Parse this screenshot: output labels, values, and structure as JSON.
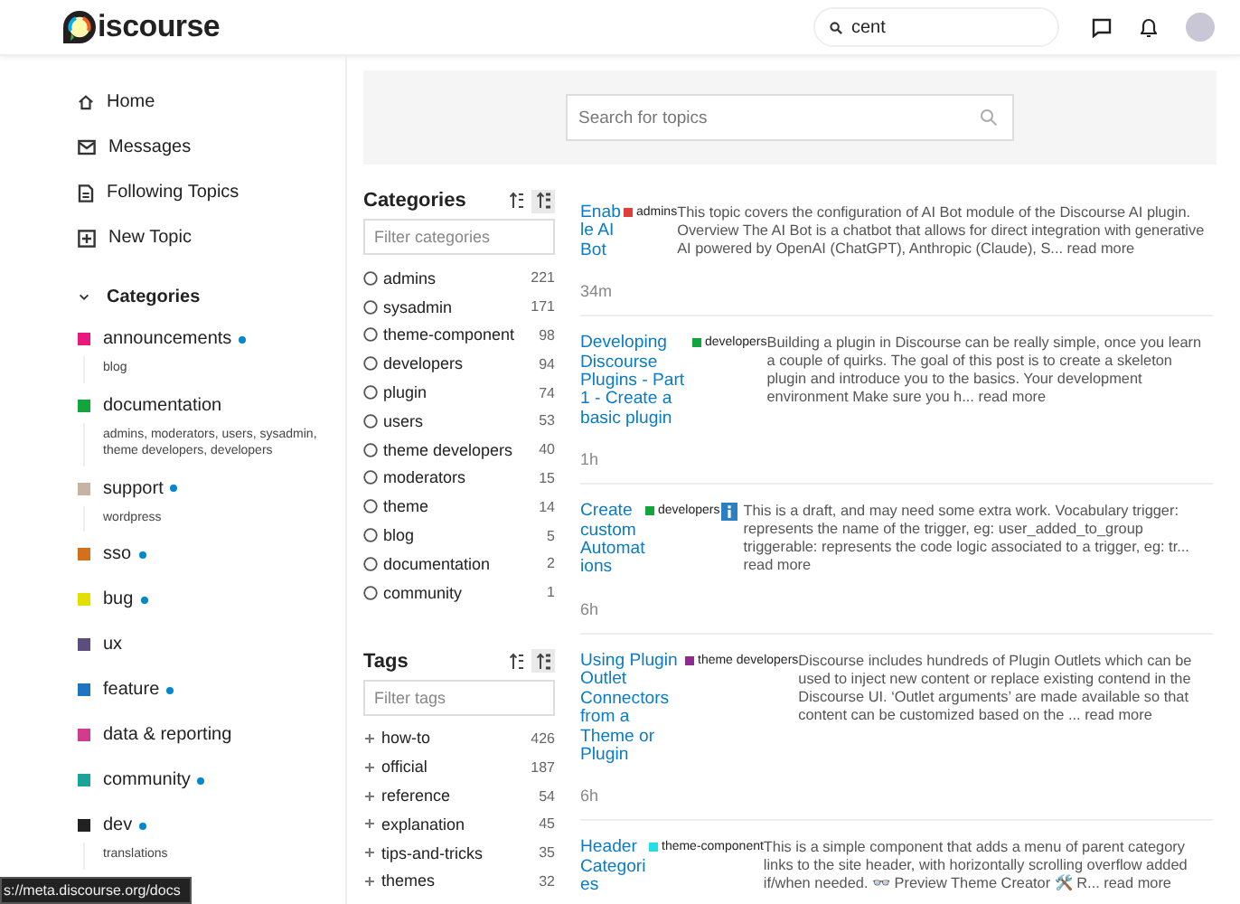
{
  "header": {
    "logo_text": "iscourse",
    "search": {
      "value": "cent"
    }
  },
  "sidebar": {
    "nav": [
      {
        "label": "Home"
      },
      {
        "label": "Messages"
      },
      {
        "label": "Following Topics"
      },
      {
        "label": "New Topic"
      }
    ],
    "categories_heading": "Categories",
    "categories": [
      {
        "name": "announcements",
        "color": "#e8197a",
        "unread": true,
        "subcategories": "blog"
      },
      {
        "name": "documentation",
        "color": "#12a53b",
        "unread": false,
        "subcategories": "admins, moderators, users, sysadmin, theme developers, developers"
      },
      {
        "name": "support",
        "color": "#c8b2a6",
        "unread": true,
        "subcategories": "wordpress"
      },
      {
        "name": "sso",
        "color": "#d4701c",
        "unread": true
      },
      {
        "name": "bug",
        "color": "#e3e000",
        "unread": true
      },
      {
        "name": "ux",
        "color": "#5b4e7e",
        "unread": false
      },
      {
        "name": "feature",
        "color": "#1f74c2",
        "unread": true
      },
      {
        "name": "data & reporting",
        "color": "#d13c8e",
        "unread": false
      },
      {
        "name": "community",
        "color": "#1ba397",
        "unread": true
      },
      {
        "name": "dev",
        "color": "#222222",
        "unread": true,
        "subcategories": "translations"
      }
    ]
  },
  "search_banner": {
    "placeholder": "Search for topics"
  },
  "filters": [
    {
      "kind": "radio",
      "heading": "Categories",
      "placeholder": "Filter categories",
      "sort": [
        {
          "selected": false
        },
        {
          "selected": true
        }
      ],
      "items": [
        {
          "name": "admins",
          "count": "221",
          "selected": false
        },
        {
          "name": "sysadmin",
          "count": "171",
          "selected": false
        },
        {
          "name": "theme-component",
          "count": "98",
          "selected": false
        },
        {
          "name": "developers",
          "count": "94",
          "selected": false
        },
        {
          "name": "plugin",
          "count": "74",
          "selected": false
        },
        {
          "name": "users",
          "count": "53",
          "selected": false
        },
        {
          "name": "theme developers",
          "count": "40",
          "selected": false
        },
        {
          "name": "moderators",
          "count": "15",
          "selected": false
        },
        {
          "name": "theme",
          "count": "14",
          "selected": false
        },
        {
          "name": "blog",
          "count": "5",
          "selected": false
        },
        {
          "name": "documentation",
          "count": "2",
          "selected": false
        },
        {
          "name": "community",
          "count": "1",
          "selected": false
        }
      ]
    },
    {
      "kind": "plus",
      "heading": "Tags",
      "placeholder": "Filter tags",
      "sort": [
        {
          "selected": false
        },
        {
          "selected": true
        }
      ],
      "items": [
        {
          "name": "how-to",
          "count": "426"
        },
        {
          "name": "official",
          "count": "187"
        },
        {
          "name": "reference",
          "count": "54"
        },
        {
          "name": "explanation",
          "count": "45"
        },
        {
          "name": "tips-and-tricks",
          "count": "35"
        },
        {
          "name": "themes",
          "count": "32"
        }
      ]
    }
  ],
  "topics": [
    {
      "title": "Enable AI Bot",
      "category": "admins",
      "color": "#e0403a",
      "info": false,
      "excerpt": "This topic covers the configuration of AI Bot module of the Discourse AI plugin. Overview The AI Bot is a chatbot that allows for direct integration with generative AI powered by OpenAI (ChatGPT), Anthropic (Claude), S...",
      "read_more": "read more",
      "age": "34m"
    },
    {
      "title": "Developing Discourse Plugins - Part 1 - Create a basic plugin",
      "category": "developers",
      "color": "#12a53b",
      "info": false,
      "excerpt": "Building a plugin in Discourse can be really simple, once you learn a couple of quirks. The goal of this post is to create a skeleton plugin and introduce you to the basics. Your development environment Make sure you h...",
      "read_more": "read more",
      "age": "1h"
    },
    {
      "title": "Create custom Automations",
      "category": "developers",
      "color": "#12a53b",
      "info": true,
      "excerpt": "This is a draft, and may need some extra work. Vocabulary trigger: represents the name of the trigger, eg: user_added_to_group triggerable: represents the code logic associated to a trigger, eg: tr...",
      "read_more": "read more",
      "age": "6h"
    },
    {
      "title": "Using Plugin Outlet Connectors from a Theme or Plugin",
      "category": "theme developers",
      "color": "#8e2b8f",
      "info": false,
      "excerpt": "Discourse includes hundreds of Plugin Outlets which can be used to inject new content or replace existing contend in the Discourse UI. ‘Outlet arguments’ are made available so that content can be customized based on the ...",
      "read_more": "read more",
      "age": "6h"
    },
    {
      "title": "Header Categories",
      "category": "theme-component",
      "color": "#25dde8",
      "info": false,
      "excerpt": "This is a simple component that adds a menu of parent category links to the site header, with horizontally scrolling overflow added if/when needed. 👓 Preview Theme Creator 🛠️ R...",
      "read_more": "read more"
    }
  ],
  "status_url": "s://meta.discourse.org/docs"
}
